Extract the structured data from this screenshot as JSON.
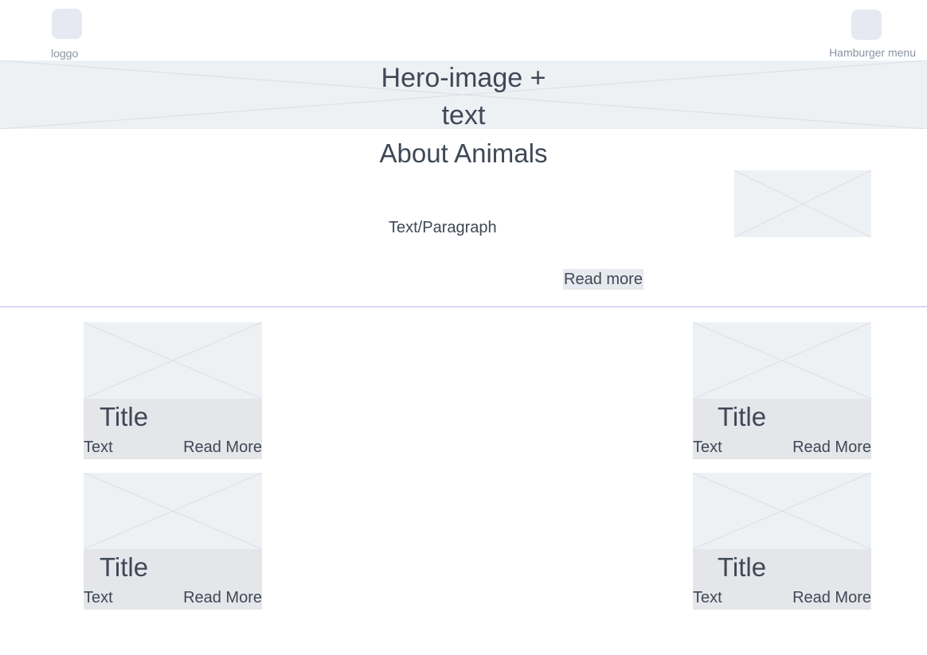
{
  "header": {
    "logo_label": "loggo",
    "menu_label": "Hamburger menu"
  },
  "hero": {
    "line1": "Hero-image +",
    "line2": "text"
  },
  "about": {
    "title": "About Animals",
    "paragraph": "Text/Paragraph",
    "read_more": "Read more"
  },
  "cards": [
    {
      "title": "Title",
      "text": "Text",
      "read_more": "Read More"
    },
    {
      "title": "Title",
      "text": "Text",
      "read_more": "Read More"
    },
    {
      "title": "Title",
      "text": "Text",
      "read_more": "Read More"
    },
    {
      "title": "Title",
      "text": "Text",
      "read_more": "Read More"
    }
  ]
}
